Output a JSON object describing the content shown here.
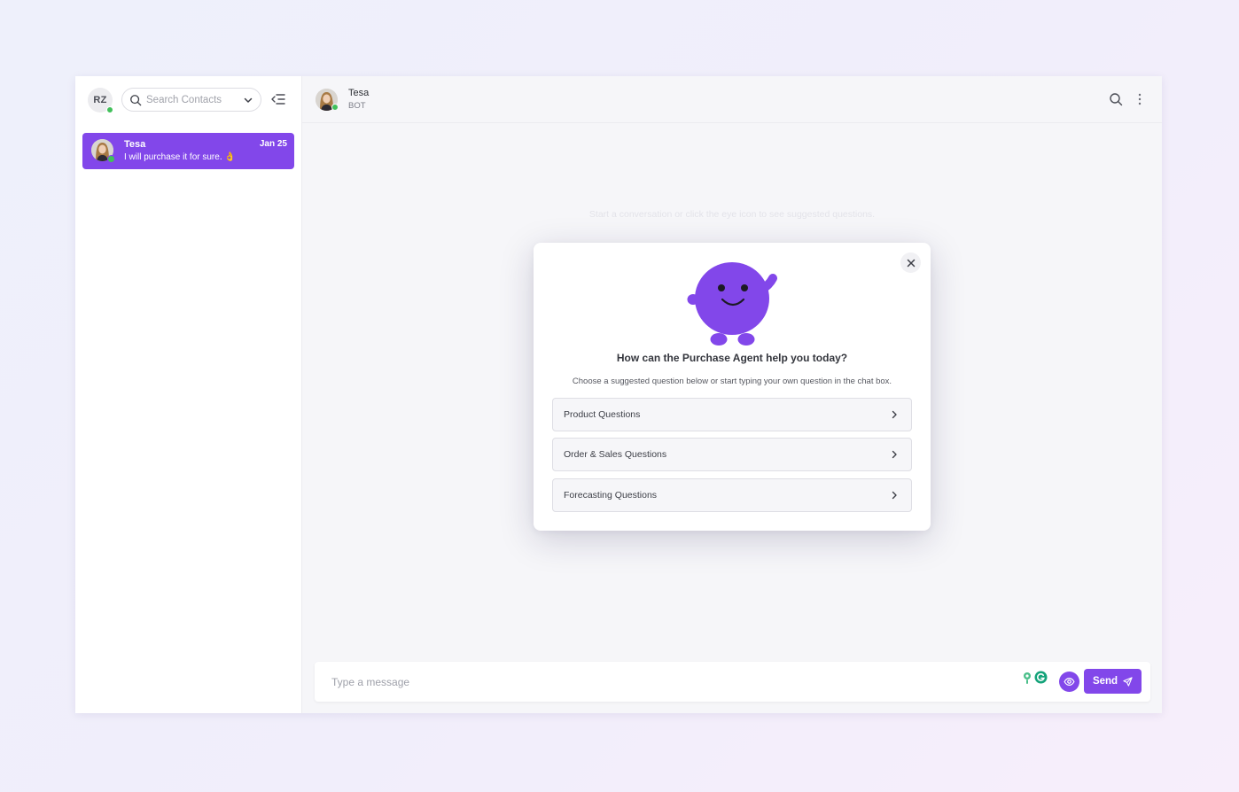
{
  "user": {
    "initials": "RZ"
  },
  "sidebar": {
    "search": {
      "placeholder": "Search Contacts"
    },
    "contacts": [
      {
        "name": "Tesa",
        "last_message": "I will purchase it for sure. 👌",
        "date": "Jan 25"
      }
    ]
  },
  "chat": {
    "header": {
      "name": "Tesa",
      "role": "BOT"
    },
    "empty_hint": "Start a conversation or click the eye icon to see suggested questions.",
    "composer": {
      "placeholder": "Type a message",
      "send_label": "Send"
    }
  },
  "modal": {
    "title": "How can the Purchase Agent help you today?",
    "subtitle": "Choose a suggested question below or start typing your own question in the chat box.",
    "options": [
      {
        "label": "Product Questions"
      },
      {
        "label": "Order & Sales Questions"
      },
      {
        "label": "Forecasting Questions"
      }
    ]
  },
  "colors": {
    "accent": "#8247ea",
    "online": "#41c05a",
    "mascot": "#8247ea"
  },
  "icons": {
    "search": "search-icon",
    "chevron": "chevron-down-icon",
    "collapse": "collapse-sidebar-icon",
    "more": "more-vertical-icon",
    "close": "close-icon",
    "eye": "eye-icon",
    "send": "send-icon",
    "option_arrow": "chevron-right-icon"
  }
}
